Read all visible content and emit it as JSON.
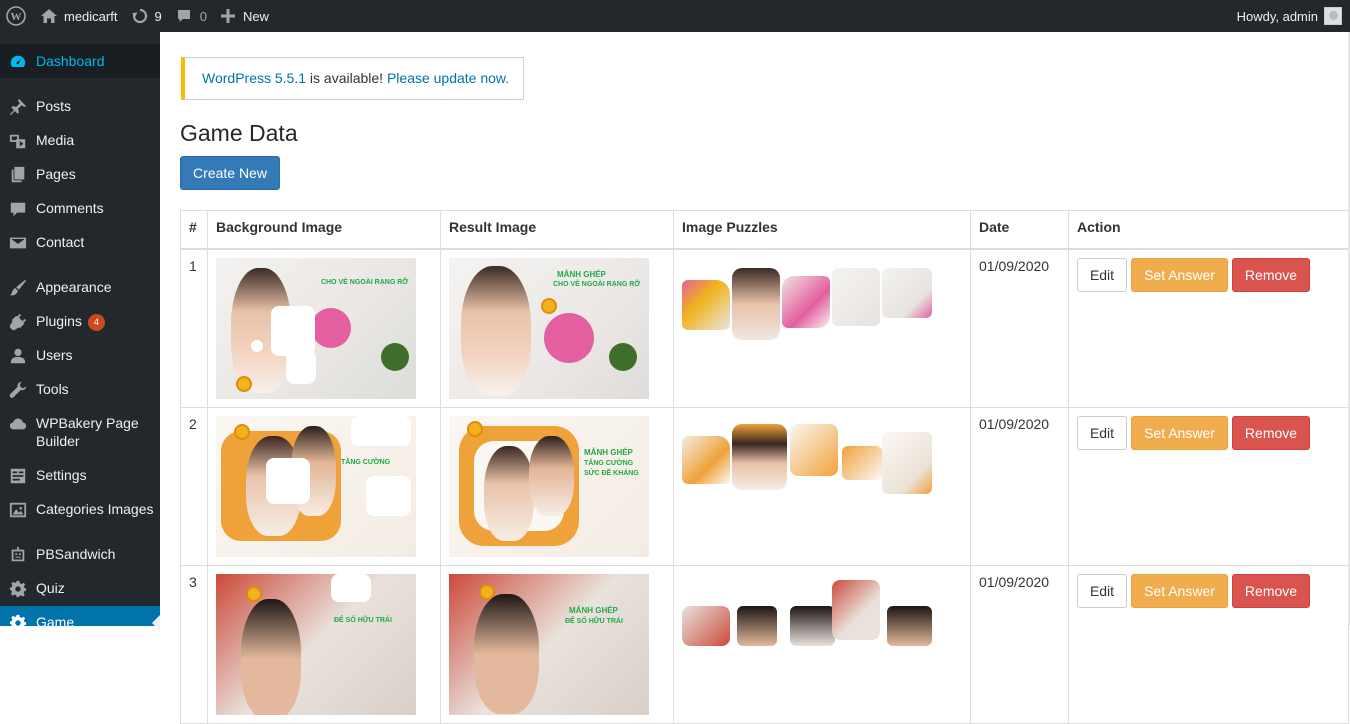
{
  "adminbar": {
    "site_name": "medicarft",
    "updates_count": "9",
    "comments_count": "0",
    "new_label": "New",
    "greeting": "Howdy, admin"
  },
  "sidebar": {
    "items": [
      {
        "label": "Dashboard",
        "icon": "dashboard-icon"
      },
      {
        "label": "Posts",
        "icon": "pin-icon"
      },
      {
        "label": "Media",
        "icon": "media-icon"
      },
      {
        "label": "Pages",
        "icon": "pages-icon"
      },
      {
        "label": "Comments",
        "icon": "comment-icon"
      },
      {
        "label": "Contact",
        "icon": "mail-icon"
      },
      {
        "label": "Appearance",
        "icon": "brush-icon"
      },
      {
        "label": "Plugins",
        "icon": "plugin-icon",
        "badge": "4"
      },
      {
        "label": "Users",
        "icon": "user-icon"
      },
      {
        "label": "Tools",
        "icon": "wrench-icon"
      },
      {
        "label": "WPBakery Page Builder",
        "icon": "cloud-icon"
      },
      {
        "label": "Settings",
        "icon": "settings-icon"
      },
      {
        "label": "Categories Images",
        "icon": "image-icon"
      },
      {
        "label": "PBSandwich",
        "icon": "robot-icon"
      },
      {
        "label": "Quiz",
        "icon": "gear-icon"
      },
      {
        "label": "Game",
        "icon": "gear-icon"
      }
    ]
  },
  "notice": {
    "version_link": "WordPress 5.5.1",
    "middle_text": " is available! ",
    "update_link": "Please update now."
  },
  "page": {
    "title": "Game Data",
    "create_button": "Create New"
  },
  "table": {
    "headers": [
      "#",
      "Background Image",
      "Result Image",
      "Image Puzzles",
      "Date",
      "Action"
    ],
    "rows": [
      {
        "num": "1",
        "date": "01/09/2020"
      },
      {
        "num": "2",
        "date": "01/09/2020"
      },
      {
        "num": "3",
        "date": "01/09/2020"
      }
    ],
    "image_captions": {
      "row1": [
        "MẢNH GHÉP",
        "CHO VẺ NGOÀI RẠNG RỠ"
      ],
      "row2": [
        "MẢNH GHÉP",
        "TĂNG CƯỜNG",
        "SỨC ĐỀ KHÁNG"
      ],
      "row3": [
        "MẢNH GHÉP",
        "ĐỂ SỐ HỮU TRÁI"
      ]
    },
    "actions": {
      "edit": "Edit",
      "set_answer": "Set Answer",
      "remove": "Remove"
    }
  },
  "colors": {
    "adminbar": "#23282d",
    "menu_active": "#0073aa",
    "link": "#0073aa",
    "notice_border": "#ffb900",
    "primary": "#337ab7",
    "warning": "#f0ad4e",
    "danger": "#d9534f",
    "badge": "#ca4a1f"
  }
}
